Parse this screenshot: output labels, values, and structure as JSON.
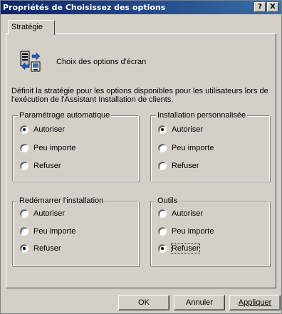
{
  "window": {
    "title": "Propriétés de Choisissez des options",
    "help_glyph": "?",
    "close_glyph": "X"
  },
  "tabs": [
    {
      "label": "Stratégie",
      "selected": true
    }
  ],
  "header": {
    "icon": "policy-settings-icon",
    "title": "Choix des options d'écran"
  },
  "description": "Définit la stratégie pour les options disponibles pour les utilisateurs lors de l'exécution de l'Assistant Installation de clients.",
  "groups": [
    {
      "title": "Paramétrage automatique",
      "options": [
        "Autoriser",
        "Peu importe",
        "Refuser"
      ],
      "selected": "Autoriser"
    },
    {
      "title": "Installation personnalisée",
      "options": [
        "Autoriser",
        "Peu importe",
        "Refuser"
      ],
      "selected": "Autoriser"
    },
    {
      "title": "Redémarrer l'installation",
      "options": [
        "Autoriser",
        "Peu importe",
        "Refuser"
      ],
      "selected": "Refuser"
    },
    {
      "title": "Outils",
      "options": [
        "Autoriser",
        "Peu importe",
        "Refuser"
      ],
      "selected": "Refuser",
      "focused": "Refuser"
    }
  ],
  "buttons": {
    "ok": "OK",
    "cancel": "Annuler",
    "apply": "Appliquer"
  },
  "colors": {
    "title_bar_start": "#0a246a",
    "title_bar_end": "#3a6ea5",
    "dialog_face": "#d4d0c8"
  }
}
